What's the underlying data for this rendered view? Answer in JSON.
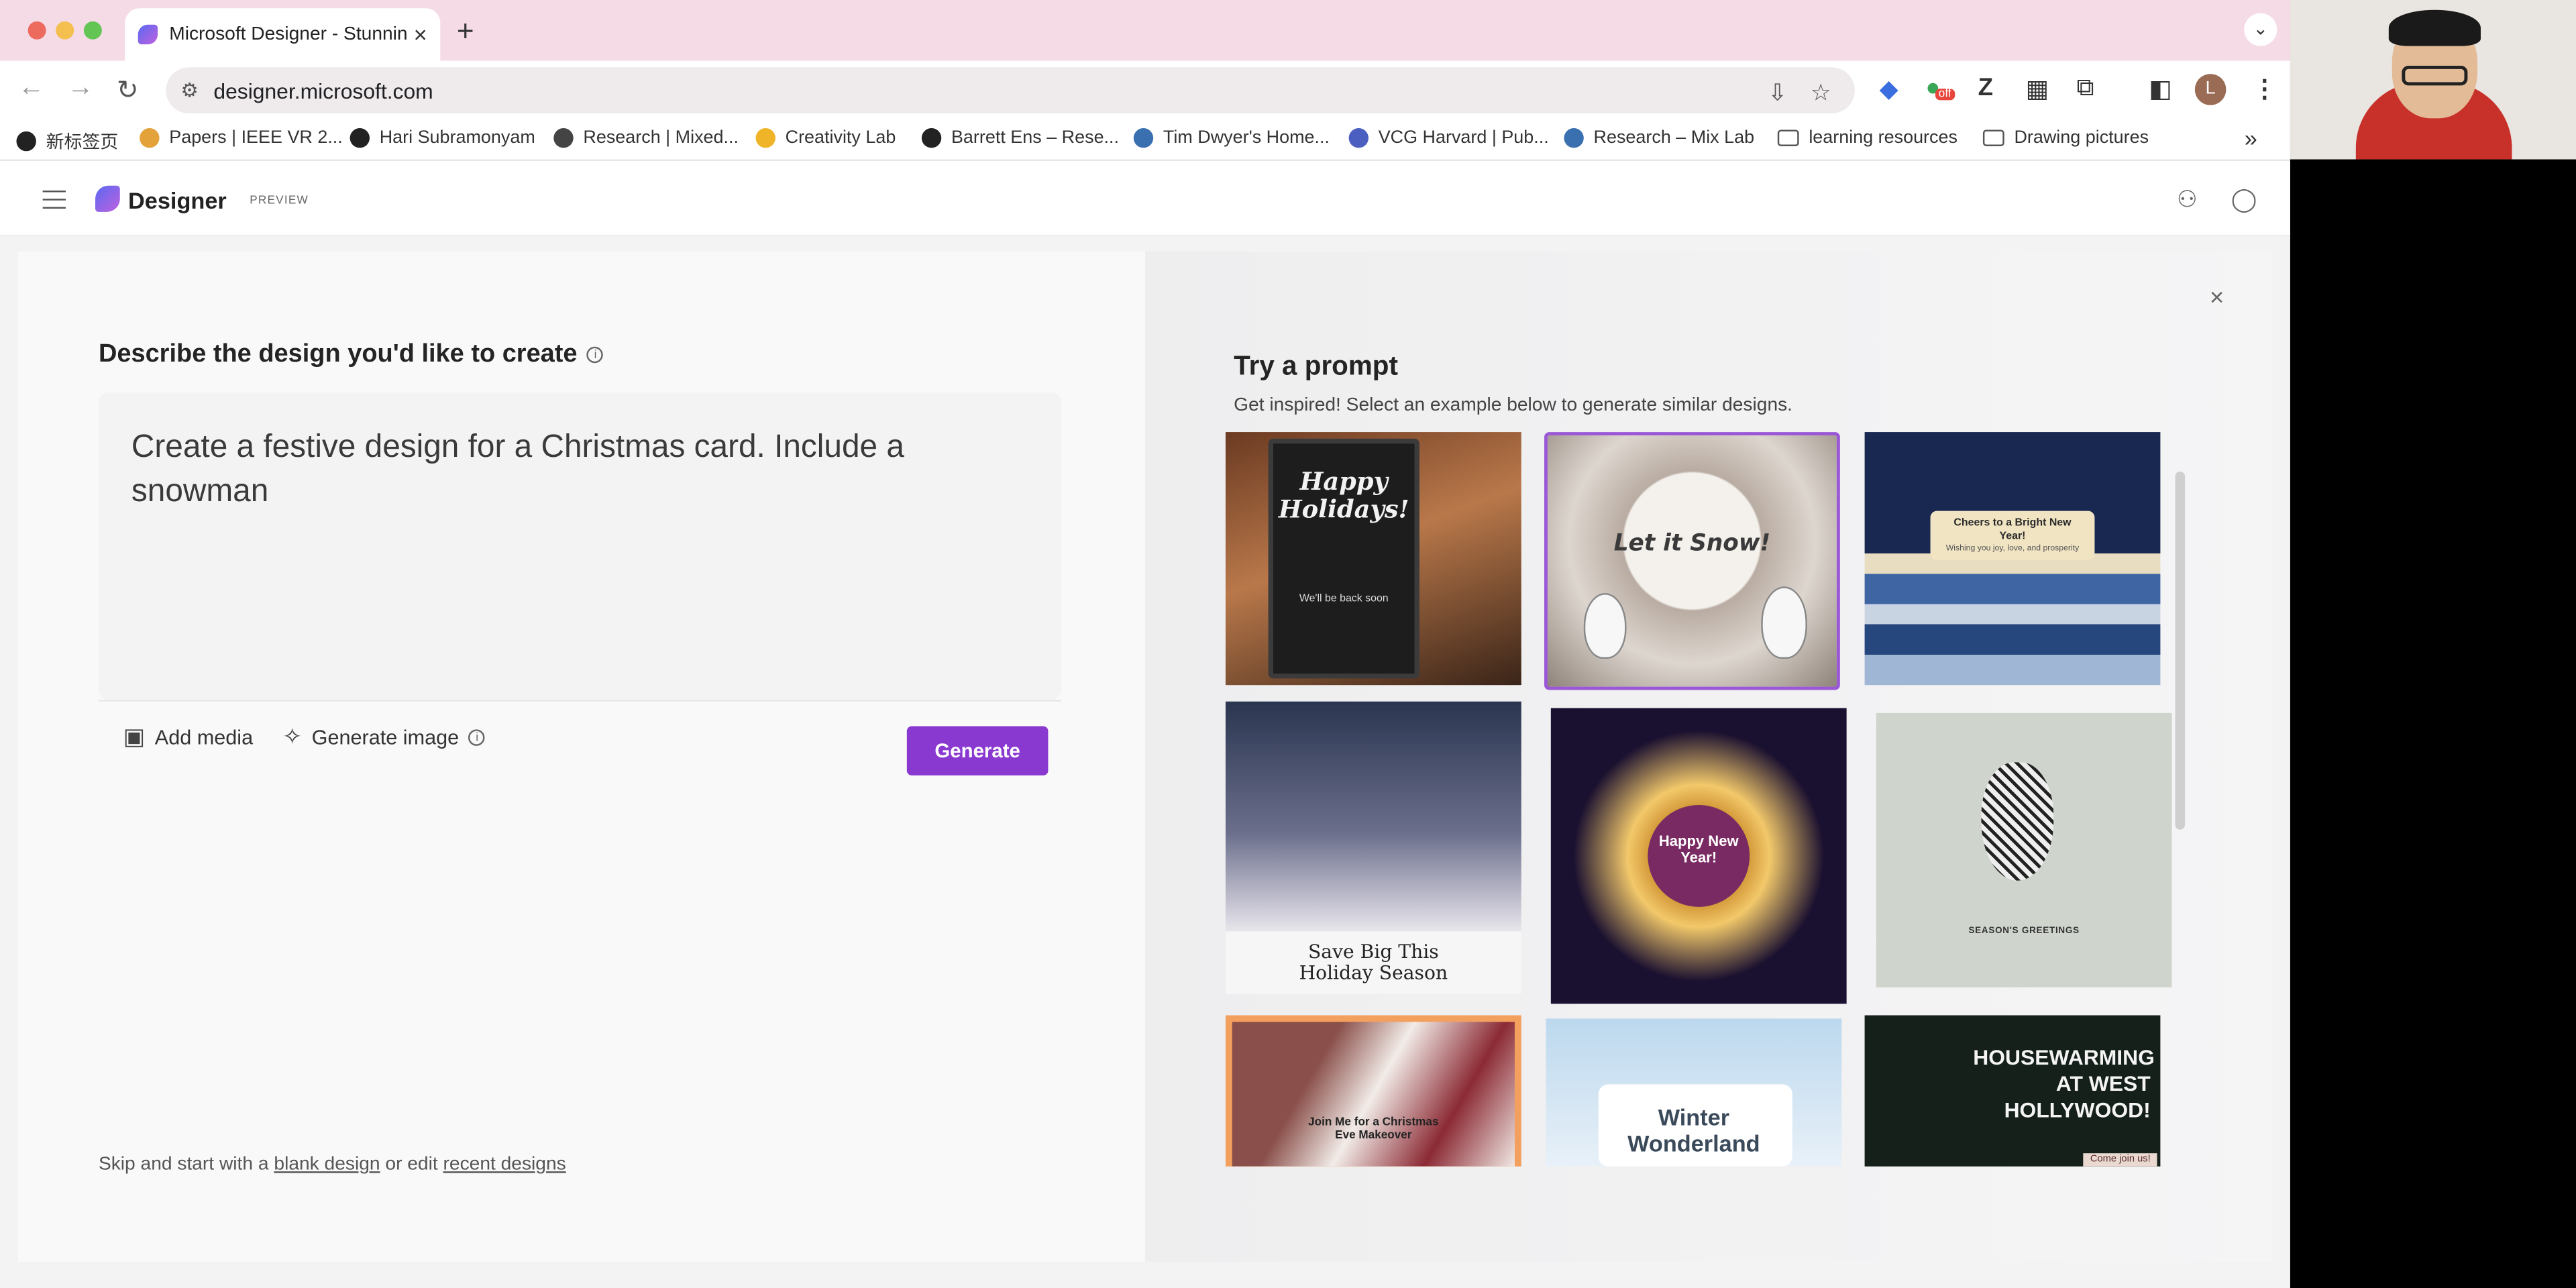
{
  "browser": {
    "tab_title": "Microsoft Designer - Stunnin",
    "tab_close": "×",
    "new_tab": "+",
    "tab_list_icon": "chevron-down-icon",
    "url": "designer.microsoft.com",
    "bookmarks": [
      {
        "label": "新标签页",
        "icon": "globe-icon"
      },
      {
        "label": "Papers | IEEE VR 2...",
        "icon": "ieee-icon"
      },
      {
        "label": "Hari Subramonyam",
        "icon": "globe-icon"
      },
      {
        "label": "Research | Mixed...",
        "icon": "research-icon"
      },
      {
        "label": "Creativity Lab",
        "icon": "emoji-icon"
      },
      {
        "label": "Barrett Ens – Rese...",
        "icon": "globe-icon"
      },
      {
        "label": "Tim Dwyer's Home...",
        "icon": "wordpress-icon"
      },
      {
        "label": "VCG Harvard | Pub...",
        "icon": "vcg-icon"
      },
      {
        "label": "Research – Mix Lab",
        "icon": "wordpress-icon"
      },
      {
        "label": "learning resources",
        "icon": "folder-icon"
      },
      {
        "label": "Drawing pictures",
        "icon": "folder-icon"
      }
    ],
    "bookmarks_more": "»",
    "profile_initial": "L",
    "extension_badge": "off"
  },
  "app": {
    "brand": "Designer",
    "badge": "PREVIEW"
  },
  "create": {
    "heading": "Describe the design you'd like to create",
    "info": "i",
    "prompt_text": "Create a festive design for a Christmas card. Include a snowman",
    "add_media": "Add media",
    "generate_image": "Generate image",
    "generate_button": "Generate",
    "skip_prefix": "Skip and start with a",
    "blank_design": "blank design",
    "skip_middle": "or edit",
    "recent_designs": "recent designs"
  },
  "inspire": {
    "close": "×",
    "title": "Try a prompt",
    "subtitle": "Get inspired! Select an example below to generate similar designs.",
    "cards": [
      {
        "text": "Happy Holidays!",
        "sub": "We'll be back soon"
      },
      {
        "text": "Let it Snow!"
      },
      {
        "text": "Cheers to a Bright New Year!",
        "sub": "Wishing you joy, love, and prosperity"
      },
      {
        "text": "Save Big This Holiday Season"
      },
      {
        "text": "Happy New Year!"
      },
      {
        "text": "SEASON'S GREETINGS"
      },
      {
        "text": "Join Me for a Christmas Eve Makeover"
      },
      {
        "text": "Winter Wonderland"
      },
      {
        "text": "HOUSEWARMING AT WEST HOLLYWOOD!",
        "sub": "Come join us!"
      }
    ]
  },
  "colors": {
    "accent": "#8a39d0",
    "tabbar": "#f5dbe6"
  }
}
